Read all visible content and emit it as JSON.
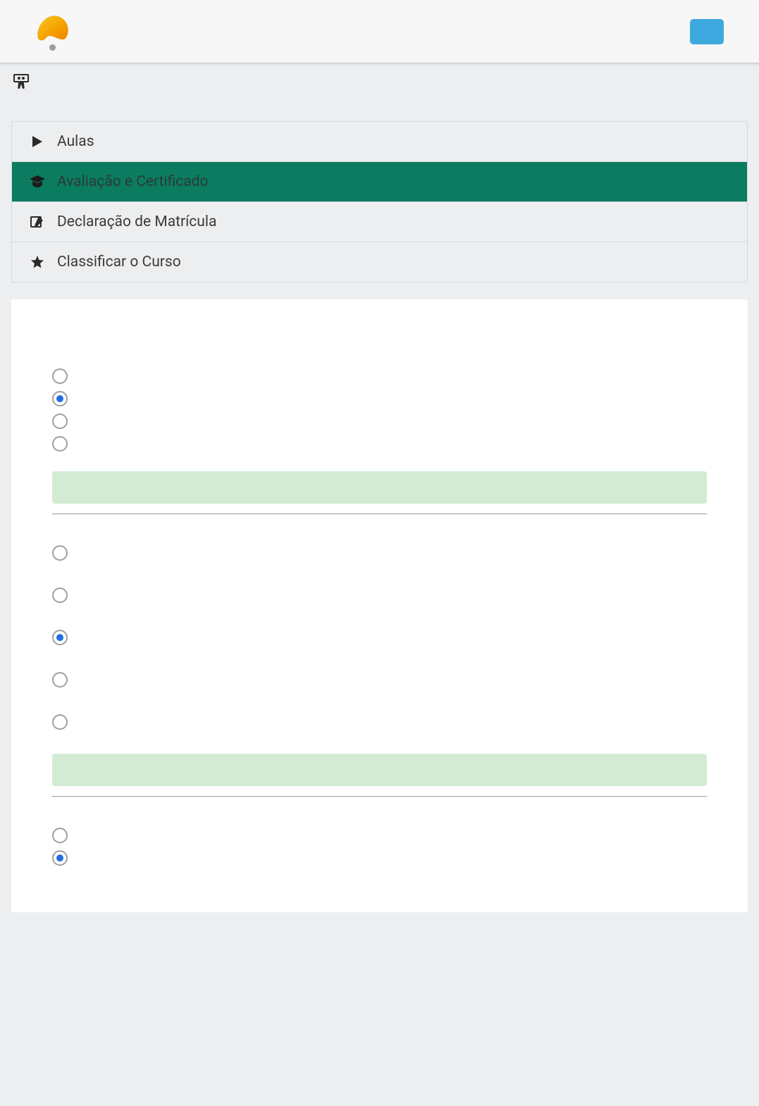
{
  "tabs": {
    "aulas": {
      "label": "Aulas"
    },
    "avaliacao": {
      "label": "Avaliação e Certificado"
    },
    "declaracao": {
      "label": "Declaração de Matrícula"
    },
    "classificar": {
      "label": "Classificar o Curso"
    }
  },
  "icons": {
    "slideshare": "slideshare-icon",
    "play": "play-icon",
    "grad": "graduation-cap-icon",
    "pen": "pen-square-icon",
    "star": "star-icon"
  },
  "questions": [
    {
      "options": [
        "",
        "",
        "",
        ""
      ],
      "selectedIndex": 1,
      "spacing": "tight",
      "showFeedback": true,
      "showDivider": true
    },
    {
      "options": [
        "",
        "",
        "",
        "",
        ""
      ],
      "selectedIndex": 2,
      "spacing": "spaced",
      "showFeedback": true,
      "showDivider": true
    },
    {
      "options": [
        "",
        ""
      ],
      "selectedIndex": 1,
      "spacing": "tight",
      "showFeedback": false,
      "showDivider": false
    }
  ]
}
